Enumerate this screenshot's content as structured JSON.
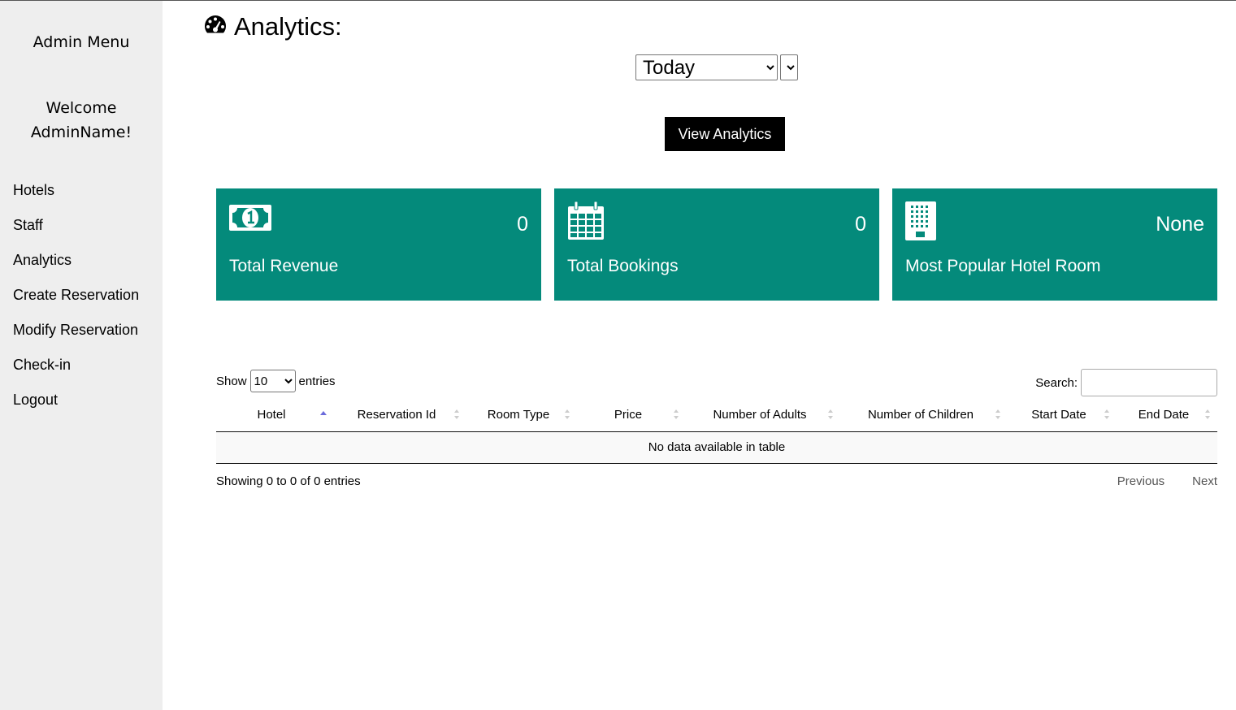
{
  "sidebar": {
    "title": "Admin Menu",
    "welcome_line1": "Welcome",
    "welcome_line2": "AdminName!",
    "items": [
      {
        "label": "Hotels"
      },
      {
        "label": "Staff"
      },
      {
        "label": "Analytics"
      },
      {
        "label": "Create Reservation"
      },
      {
        "label": "Modify Reservation"
      },
      {
        "label": "Check-in"
      },
      {
        "label": "Logout"
      }
    ]
  },
  "header": {
    "title": "Analytics:",
    "icon": "tachometer-icon"
  },
  "filters": {
    "range_value": "Today",
    "range_options": [
      "Today"
    ],
    "view_button": "View Analytics"
  },
  "cards": [
    {
      "icon": "money-bill-icon",
      "value": "0",
      "label": "Total Revenue"
    },
    {
      "icon": "calendar-icon",
      "value": "0",
      "label": "Total Bookings"
    },
    {
      "icon": "building-icon",
      "value": "None",
      "label": "Most Popular Hotel Room"
    }
  ],
  "colors": {
    "card_bg": "#048a7b",
    "sidebar_bg": "#eeeeee",
    "button_bg": "#000000"
  },
  "table": {
    "show_label": "Show",
    "entries_label": "entries",
    "page_length": "10",
    "page_length_options": [
      "10"
    ],
    "search_label": "Search:",
    "columns": [
      "Hotel",
      "Reservation Id",
      "Room Type",
      "Price",
      "Number of Adults",
      "Number of Children",
      "Start Date",
      "End Date"
    ],
    "sorted_column": "Hotel",
    "empty_message": "No data available in table",
    "info": "Showing 0 to 0 of 0 entries",
    "previous": "Previous",
    "next": "Next"
  }
}
